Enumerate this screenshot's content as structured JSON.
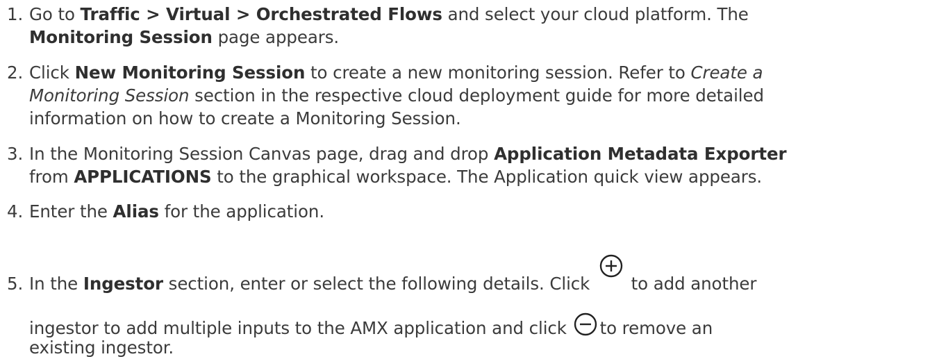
{
  "steps": [
    {
      "num": "1.",
      "t1": "Go to ",
      "b1": "Traffic > Virtual > Orchestrated Flows",
      "t2": " and select your cloud platform. The",
      "b2": "Monitoring Session",
      "t3": " page appears."
    },
    {
      "num": "2.",
      "t1": "Click ",
      "b1": "New Monitoring Session",
      "t2": " to create a new monitoring session. Refer to ",
      "i1": "Create a",
      "i2": "Monitoring Session",
      "t3": " section in the respective cloud deployment guide for more detailed",
      "t4": "information on how to create a Monitoring Session."
    },
    {
      "num": "3.",
      "t1": "In the Monitoring Session Canvas page, drag and drop ",
      "b1": "Application Metadata Exporter",
      "t2": "from ",
      "b2": "APPLICATIONS",
      "t3": " to the graphical workspace. The Application quick view appears."
    },
    {
      "num": "4.",
      "t1": "Enter the ",
      "b1": "Alias",
      "t2": " for the application."
    },
    {
      "num": "5.",
      "t1": "In the ",
      "b1": "Ingestor",
      "t2": " section, enter or select the following details. Click ",
      "t3": " to add another",
      "t4": "ingestor to add multiple inputs to the AMX application and click ",
      "t5": "to remove an",
      "t6": "existing ingestor.",
      "icon_add": "plus-circle-icon",
      "icon_remove": "minus-circle-icon"
    }
  ]
}
